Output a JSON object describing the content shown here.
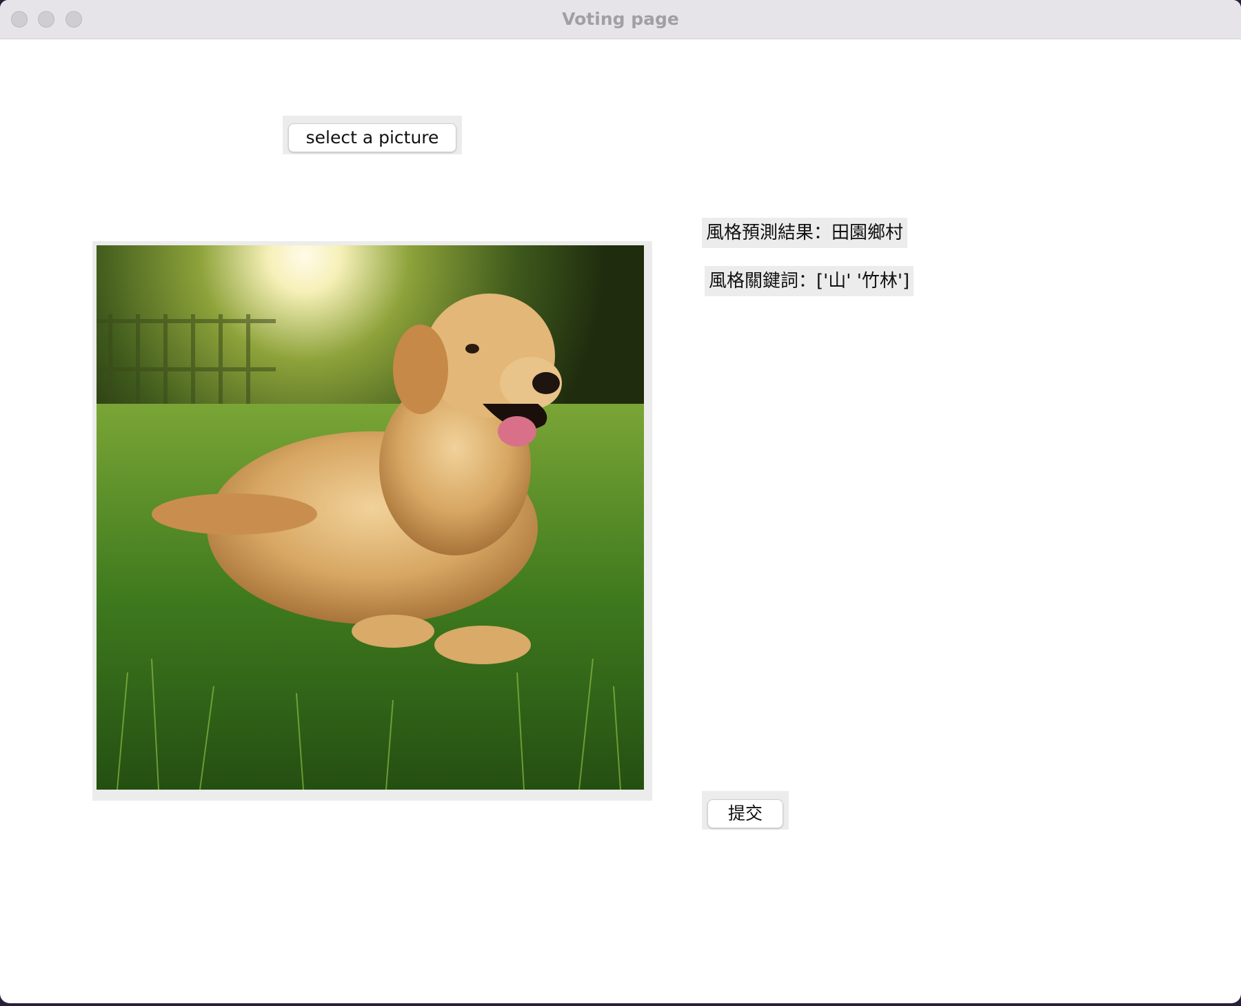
{
  "window": {
    "title": "Voting page"
  },
  "toolbar": {
    "select_label": "select a picture"
  },
  "results": {
    "style_prediction": "風格預測結果：田園鄉村",
    "style_keywords": "風格關鍵詞：['山' '竹林']"
  },
  "image": {
    "description_icon": "golden-retriever-photo"
  },
  "actions": {
    "submit_label": "提交"
  }
}
